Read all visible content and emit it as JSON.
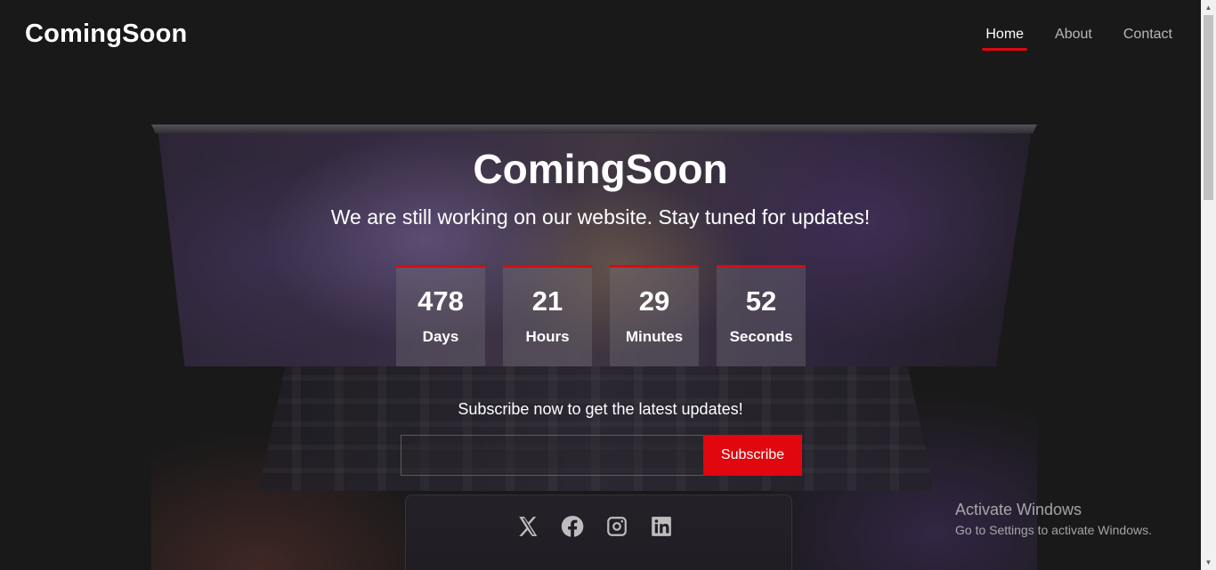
{
  "header": {
    "brand": "ComingSoon",
    "nav": [
      {
        "label": "Home",
        "active": true
      },
      {
        "label": "About",
        "active": false
      },
      {
        "label": "Contact",
        "active": false
      }
    ]
  },
  "hero": {
    "title": "ComingSoon",
    "subtitle": "We are still working on our website. Stay tuned for updates!"
  },
  "countdown": [
    {
      "value": "478",
      "label": "Days"
    },
    {
      "value": "21",
      "label": "Hours"
    },
    {
      "value": "29",
      "label": "Minutes"
    },
    {
      "value": "52",
      "label": "Seconds"
    }
  ],
  "subscribe": {
    "text": "Subscribe now to get the latest updates!",
    "input_value": "",
    "button_label": "Subscribe"
  },
  "social": [
    "x-icon",
    "facebook-icon",
    "instagram-icon",
    "linkedin-icon"
  ],
  "watermark": {
    "line1": "Activate Windows",
    "line2": "Go to Settings to activate Windows."
  },
  "colors": {
    "accent": "#e0080e",
    "background": "#1c1b1c"
  }
}
